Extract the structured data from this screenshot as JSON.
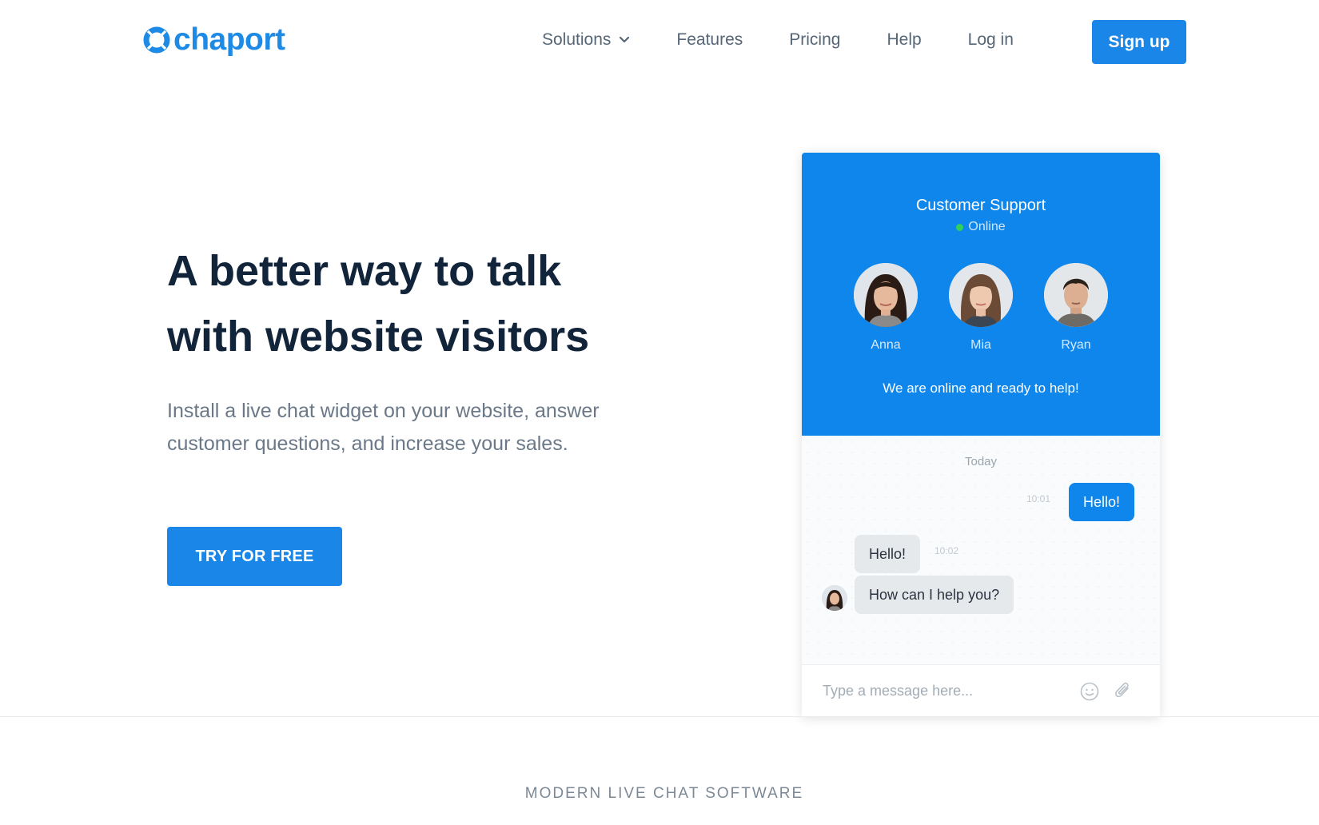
{
  "header": {
    "brand": "chaport",
    "nav": [
      {
        "label": "Solutions",
        "has_dropdown": true
      },
      {
        "label": "Features"
      },
      {
        "label": "Pricing"
      },
      {
        "label": "Help"
      },
      {
        "label": "Log in"
      }
    ],
    "signup_label": "Sign up"
  },
  "hero": {
    "title_line1": "A better way to talk",
    "title_line2": "with website visitors",
    "subtitle": "Install a live chat widget on your website, answer customer questions, and increase your sales.",
    "cta_label": "TRY FOR FREE"
  },
  "widget": {
    "title": "Customer Support",
    "status": "Online",
    "agents": [
      {
        "name": "Anna"
      },
      {
        "name": "Mia"
      },
      {
        "name": "Ryan"
      }
    ],
    "message": "We are online and ready to help!",
    "day_label": "Today",
    "outgoing": {
      "text": "Hello!",
      "time": "10:01"
    },
    "incoming": [
      {
        "text": "Hello!",
        "time": "10:02"
      },
      {
        "text": "How can I help you?"
      }
    ],
    "input_placeholder": "Type a message here..."
  },
  "section": {
    "label": "MODERN LIVE CHAT SOFTWARE"
  },
  "colors": {
    "brand_blue": "#1a86e8",
    "widget_header": "#0e86eb",
    "online_green": "#2fd15b",
    "heading": "#12243a"
  }
}
